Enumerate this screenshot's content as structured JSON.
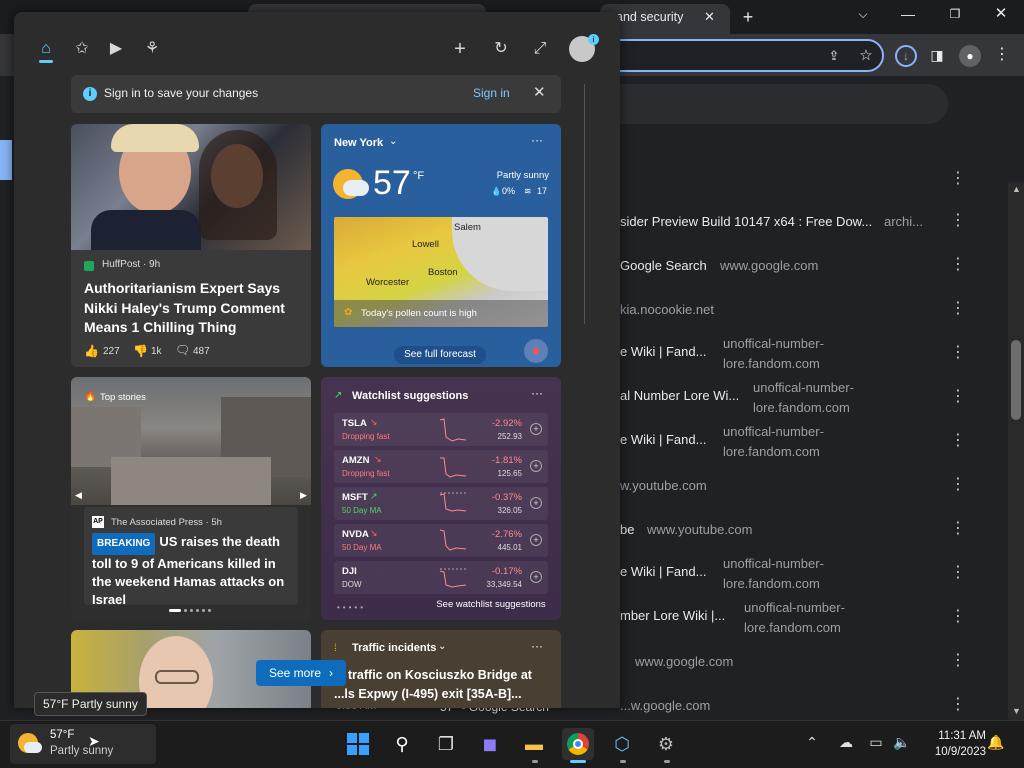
{
  "browser": {
    "active_tab_title": "and security",
    "history_rows": [
      {
        "title": "sider Preview Build 10147 x64 : Free Dow...",
        "domain": "archi..."
      },
      {
        "title": "Google Search",
        "domain": "www.google.com"
      },
      {
        "title": "kia.nocookie.net",
        "domain": ""
      },
      {
        "title": "e Wiki | Fand...",
        "domain": "unoffical-number-lore.fandom.com"
      },
      {
        "title": "al Number Lore Wi...",
        "domain": "unoffical-number-lore.fandom.com"
      },
      {
        "title": "e Wiki | Fand...",
        "domain": "unoffical-number-lore.fandom.com"
      },
      {
        "title": "w.youtube.com",
        "domain": ""
      },
      {
        "title": "be",
        "domain": "www.youtube.com"
      },
      {
        "title": "e Wiki | Fand...",
        "domain": "unoffical-number-lore.fandom.com"
      },
      {
        "title": "mber Lore Wiki |...",
        "domain": "unoffical-number-lore.fandom.com"
      },
      {
        "title": "",
        "domain": "www.google.com"
      },
      {
        "title": "",
        "domain": "...w.google.com"
      }
    ],
    "partial_bottom": {
      "time": "9:56 AM",
      "text": "57° - Google Search"
    }
  },
  "widgets": {
    "signin_banner": {
      "text": "Sign in to save your changes",
      "link": "Sign in"
    },
    "news1": {
      "source": "HuffPost · 9h",
      "headline": "Authoritarianism Expert Says Nikki Haley's Trump Comment Means 1 Chilling Thing",
      "likes": "227",
      "dislikes": "1k",
      "comments": "487"
    },
    "weather": {
      "location": "New York",
      "temp": "57",
      "unit": "°F",
      "condition": "Partly sunny",
      "precip": "0%",
      "wind": "17",
      "map_labels": [
        "Lowell",
        "Worcester",
        "Boston",
        "Salem"
      ],
      "pollen": "Today's pollen count is high",
      "cta": "See full forecast"
    },
    "top_stories": {
      "label": "Top stories",
      "source": "The Associated Press · 5h",
      "badge": "BREAKING",
      "headline": "US raises the death toll to 9 of Americans killed in the weekend Hamas attacks on Israel"
    },
    "watchlist": {
      "title": "Watchlist suggestions",
      "rows": [
        {
          "symbol": "TSLA",
          "sub": "Dropping fast",
          "pct": "-2.92%",
          "price": "252.93"
        },
        {
          "symbol": "AMZN",
          "sub": "Dropping fast",
          "pct": "-1.81%",
          "price": "125.65"
        },
        {
          "symbol": "MSFT",
          "sub": "50 Day MA",
          "pct": "-0.37%",
          "price": "326.05"
        },
        {
          "symbol": "NVDA",
          "sub": "50 Day MA",
          "pct": "-2.76%",
          "price": "445.01"
        },
        {
          "symbol": "DJI",
          "sub": "DOW",
          "pct": "-0.17%",
          "price": "33,349.54"
        }
      ],
      "cta": "See watchlist suggestions"
    },
    "traffic": {
      "title": "Traffic incidents",
      "headline": "... traffic on Kosciuszko Bridge at ...ls Expwy (I-495) exit [35A-B]..."
    },
    "see_more": "See more"
  },
  "tooltip": "57°F Partly sunny",
  "taskbar": {
    "weather_temp": "57°F",
    "weather_cond": "Partly sunny",
    "time": "11:31 AM",
    "date": "10/9/2023"
  },
  "colors": {
    "accent": "#60cdff",
    "link": "#8ab4f8",
    "negative": "#ff8a8a",
    "breaking": "#0f6cbd",
    "weather_card": "#2a5f9e"
  }
}
